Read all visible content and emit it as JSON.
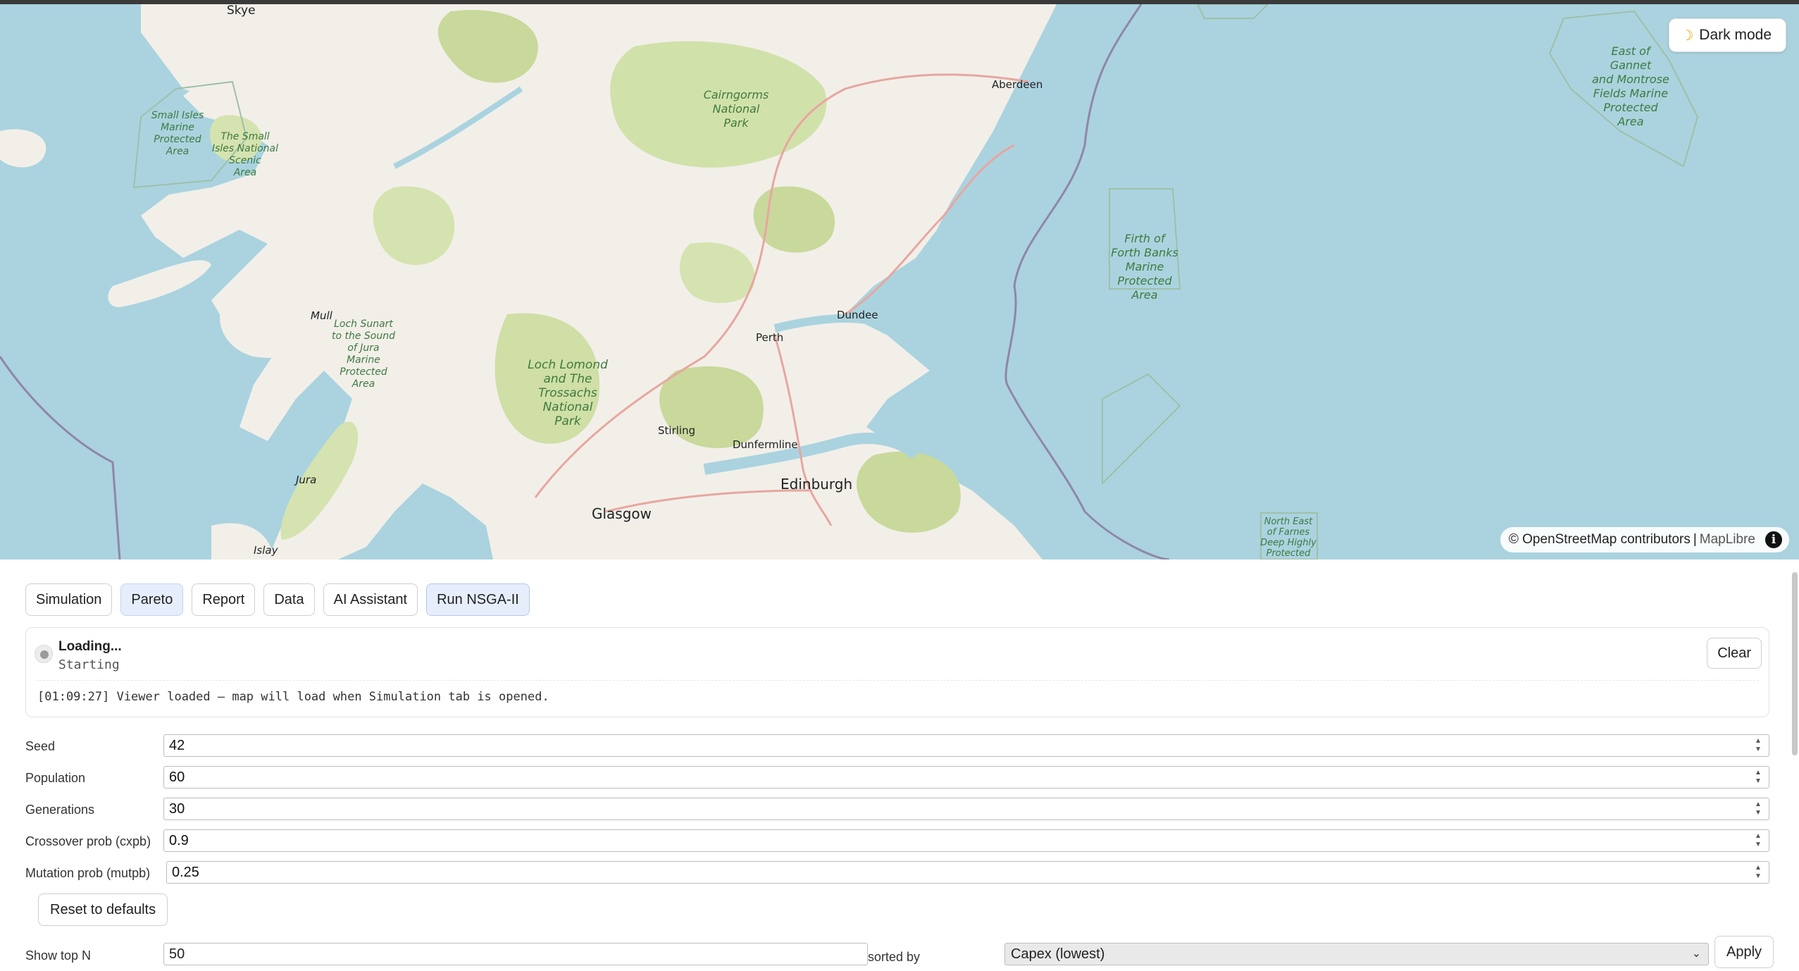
{
  "map": {
    "dark_mode_label": "Dark mode",
    "attribution": "© OpenStreetMap contributors",
    "attribution_sep": "|",
    "attribution_maplibre": "MapLibre",
    "labels": {
      "skye": "Skye",
      "aberdeen": "Aberdeen",
      "cairngorms": [
        "Cairngorms",
        "National",
        "Park"
      ],
      "small_isles_mpa": [
        "Small Isles",
        "Marine",
        "Protected",
        "Area"
      ],
      "small_isles_nsa": [
        "The Small",
        "Isles National",
        "Scenic",
        "Area"
      ],
      "east_gannet": [
        "East of",
        "Gannet",
        "and Montrose",
        "Fields Marine",
        "Protected",
        "Area"
      ],
      "firth_forth": [
        "Firth of",
        "Forth Banks",
        "Marine",
        "Protected",
        "Area"
      ],
      "mull": "Mull",
      "loch_sunart": [
        "Loch Sunart",
        "to the Sound",
        "of Jura",
        "Marine",
        "Protected",
        "Area"
      ],
      "loch_lomond": [
        "Loch Lomond",
        "and The",
        "Trossachs",
        "National",
        "Park"
      ],
      "dundee": "Dundee",
      "perth": "Perth",
      "stirling": "Stirling",
      "dunfermline": "Dunfermline",
      "edinburgh": "Edinburgh",
      "glasgow": "Glasgow",
      "jura": "Jura",
      "islay": "Islay",
      "north_east_farnes": [
        "North East",
        "of Farnes",
        "Deep Highly",
        "Protected"
      ]
    }
  },
  "tabs": [
    {
      "label": "Simulation"
    },
    {
      "label": "Pareto"
    },
    {
      "label": "Report"
    },
    {
      "label": "Data"
    },
    {
      "label": "AI Assistant"
    },
    {
      "label": "Run NSGA-II"
    }
  ],
  "status": {
    "title": "Loading...",
    "subtitle": "Starting",
    "clear_label": "Clear",
    "log": "[01:09:27] Viewer loaded — map will load when Simulation tab is opened."
  },
  "params": [
    {
      "label": "Seed",
      "value": "42"
    },
    {
      "label": "Population",
      "value": "60"
    },
    {
      "label": "Generations",
      "value": "30"
    },
    {
      "label": "Crossover prob (cxpb)",
      "value": "0.9"
    },
    {
      "label": "Mutation prob (mutpb)",
      "value": "0.25"
    }
  ],
  "reset_label": "Reset to defaults",
  "bottom": {
    "show_top_label": "Show top N",
    "show_top_value": "50",
    "sorted_by_label": "sorted by",
    "sort_value": "Capex (lowest)",
    "apply_label": "Apply"
  }
}
